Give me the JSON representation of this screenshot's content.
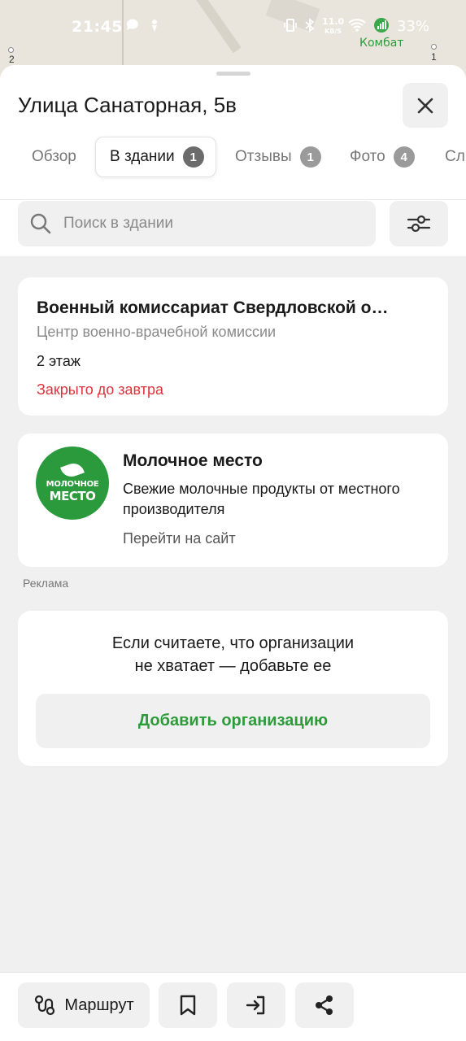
{
  "status_bar": {
    "time": "21:45",
    "network_speed_value": "11.0",
    "network_speed_unit": "KB/S",
    "battery": "33%"
  },
  "map": {
    "place_label": "Комбат",
    "pin_left_label": "2",
    "pin_right_label": "1"
  },
  "sheet": {
    "title": "Улица Санаторная, 5в",
    "tabs": [
      {
        "label": "Обзор",
        "count": ""
      },
      {
        "label": "В здании",
        "count": "1",
        "active": true
      },
      {
        "label": "Отзывы",
        "count": "1"
      },
      {
        "label": "Фото",
        "count": "4"
      },
      {
        "label": "Сл",
        "count": ""
      }
    ],
    "search": {
      "placeholder": "Поиск в здании"
    }
  },
  "organization": {
    "name": "Военный комиссариат Свердловской о…",
    "category": "Центр военно-врачебной комиссии",
    "floor": "2 этаж",
    "hours_status": "Закрыто до завтра",
    "hours_color": "#e0323c"
  },
  "ad": {
    "logo_line1": "МОЛОЧНОЕ",
    "logo_line2": "МЕСТО",
    "title": "Молочное место",
    "description": "Свежие молочные продукты от местного производителя",
    "link": "Перейти на сайт",
    "label": "Реклама",
    "brand_color": "#2a9a3c"
  },
  "add_org": {
    "line1": "Если считаете, что организации",
    "line2": "не хватает — добавьте ее",
    "button": "Добавить организацию",
    "accent": "#2e9b3a"
  },
  "bottom_bar": {
    "route_label": "Маршрут",
    "icons": [
      "route-icon",
      "bookmark-icon",
      "enter-icon",
      "share-icon"
    ]
  }
}
